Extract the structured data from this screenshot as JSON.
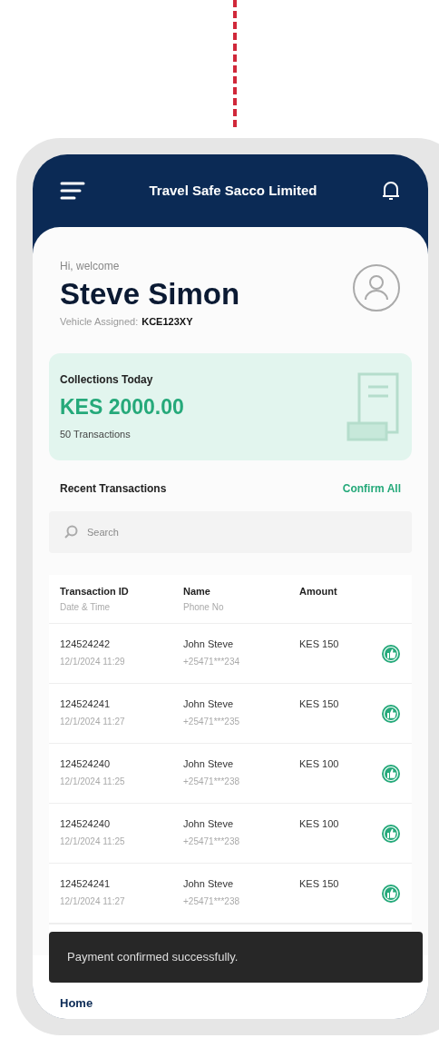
{
  "header": {
    "title": "Travel Safe Sacco Limited"
  },
  "profile": {
    "greeting": "Hi, welcome",
    "name": "Steve Simon",
    "vehicle_label": "Vehicle Assigned:",
    "vehicle": "KCE123XY"
  },
  "collections": {
    "title": "Collections Today",
    "amount": "KES 2000.00",
    "count": "50 Transactions"
  },
  "recent": {
    "title": "Recent Transactions",
    "action": "Confirm All"
  },
  "search": {
    "placeholder": "Search"
  },
  "table": {
    "columns": [
      {
        "title": "Transaction ID",
        "subtitle": "Date & Time"
      },
      {
        "title": "Name",
        "subtitle": "Phone No"
      },
      {
        "title": "Amount"
      }
    ],
    "rows": [
      {
        "id": "124524242",
        "date": "12/1/2024 11:29",
        "name": "John Steve",
        "phone": "+25471***234",
        "amount": "KES 150",
        "confirmed": true
      },
      {
        "id": "124524241",
        "date": "12/1/2024 11:27",
        "name": "John Steve",
        "phone": "+25471***235",
        "amount": "KES 150",
        "confirmed": true
      },
      {
        "id": "124524240",
        "date": "12/1/2024 11:25",
        "name": "John Steve",
        "phone": "+25471***238",
        "amount": "KES 100",
        "confirmed": true
      },
      {
        "id": "124524240",
        "date": "12/1/2024 11:25",
        "name": "John Steve",
        "phone": "+25471***238",
        "amount": "KES 100",
        "confirmed": true
      },
      {
        "id": "124524241",
        "date": "12/1/2024 11:27",
        "name": "John Steve",
        "phone": "+25471***238",
        "amount": "KES 150",
        "confirmed": true
      }
    ]
  },
  "nav": {
    "items": [
      {
        "label": "Home",
        "selected": true
      }
    ]
  },
  "toast": {
    "message": "Payment confirmed successfully."
  }
}
